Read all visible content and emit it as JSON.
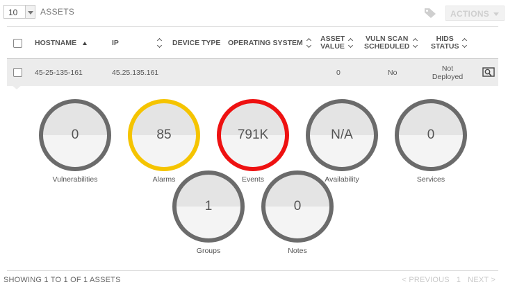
{
  "toolbar": {
    "page_size": "10",
    "assets_label": "ASSETS",
    "actions_label": "ACTIONS",
    "icon_tag": "tag-icon"
  },
  "table": {
    "columns": [
      "HOSTNAME",
      "IP",
      "DEVICE TYPE",
      "OPERATING SYSTEM",
      "ASSET VALUE",
      "VULN SCAN SCHEDULED",
      "HIDS STATUS"
    ],
    "header": {
      "hostname": "HOSTNAME",
      "ip": "IP",
      "device_type": "DEVICE TYPE",
      "os": "OPERATING SYSTEM",
      "asset_value_1": "ASSET",
      "asset_value_2": "VALUE",
      "vuln_1": "VULN SCAN",
      "vuln_2": "SCHEDULED",
      "hids_1": "HIDS",
      "hids_2": "STATUS"
    },
    "rows": [
      {
        "hostname": "45-25-135-161",
        "ip": "45.25.135.161",
        "device_type": "",
        "os": "",
        "asset_value": "0",
        "vuln_scan": "No",
        "hids_1": "Not",
        "hids_2": "Deployed"
      }
    ]
  },
  "stats": [
    {
      "label": "Vulnerabilities",
      "value": "0",
      "ring_color": "#6b6b6b"
    },
    {
      "label": "Alarms",
      "value": "85",
      "ring_color": "#f5c400"
    },
    {
      "label": "Events",
      "value": "791K",
      "ring_color": "#ee1111"
    },
    {
      "label": "Availability",
      "value": "N/A",
      "ring_color": "#6b6b6b"
    },
    {
      "label": "Services",
      "value": "0",
      "ring_color": "#6b6b6b"
    },
    {
      "label": "Groups",
      "value": "1",
      "ring_color": "#6b6b6b"
    },
    {
      "label": "Notes",
      "value": "0",
      "ring_color": "#6b6b6b"
    }
  ],
  "footer": {
    "summary": "SHOWING 1 TO 1 OF 1 ASSETS",
    "previous": "< PREVIOUS",
    "page": "1",
    "next": "NEXT >"
  }
}
